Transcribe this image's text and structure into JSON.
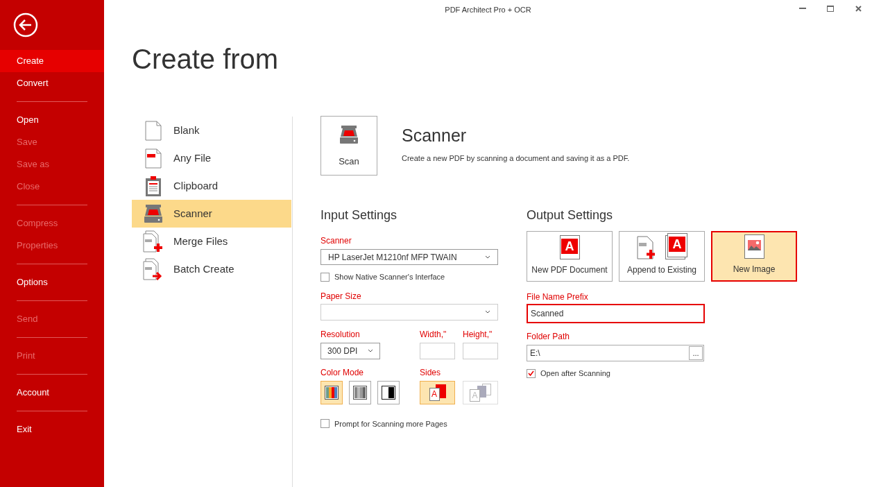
{
  "window": {
    "title": "PDF Architect Pro + OCR"
  },
  "sidebar": {
    "groups": [
      {
        "items": [
          {
            "label": "Create",
            "selected": true,
            "disabled": false
          },
          {
            "label": "Convert",
            "selected": false,
            "disabled": false
          }
        ]
      },
      {
        "items": [
          {
            "label": "Open",
            "selected": false,
            "disabled": false
          },
          {
            "label": "Save",
            "selected": false,
            "disabled": true
          },
          {
            "label": "Save as",
            "selected": false,
            "disabled": true
          },
          {
            "label": "Close",
            "selected": false,
            "disabled": true
          }
        ]
      },
      {
        "items": [
          {
            "label": "Compress",
            "selected": false,
            "disabled": true
          },
          {
            "label": "Properties",
            "selected": false,
            "disabled": true
          }
        ]
      },
      {
        "items": [
          {
            "label": "Options",
            "selected": false,
            "disabled": false
          }
        ]
      },
      {
        "items": [
          {
            "label": "Send",
            "selected": false,
            "disabled": true
          }
        ]
      },
      {
        "items": [
          {
            "label": "Print",
            "selected": false,
            "disabled": true
          }
        ]
      },
      {
        "items": [
          {
            "label": "Account",
            "selected": false,
            "disabled": false
          }
        ]
      },
      {
        "items": [
          {
            "label": "Exit",
            "selected": false,
            "disabled": false
          }
        ]
      }
    ]
  },
  "page_title": "Create from",
  "sources": [
    {
      "label": "Blank",
      "kind": "blank",
      "selected": false
    },
    {
      "label": "Any File",
      "kind": "file",
      "selected": false
    },
    {
      "label": "Clipboard",
      "kind": "clipboard",
      "selected": false
    },
    {
      "label": "Scanner",
      "kind": "scanner",
      "selected": true
    },
    {
      "label": "Merge Files",
      "kind": "merge",
      "selected": false
    },
    {
      "label": "Batch Create",
      "kind": "batch",
      "selected": false
    }
  ],
  "scan_button": {
    "label": "Scan"
  },
  "section": {
    "title": "Scanner",
    "description": "Create a new PDF by scanning a document and saving it as a PDF."
  },
  "input_settings": {
    "title": "Input Settings",
    "scanner": {
      "label": "Scanner",
      "value": "HP LaserJet M1210nf MFP TWAIN"
    },
    "show_native": {
      "label": "Show Native Scanner's Interface",
      "checked": false
    },
    "paper_size": {
      "label": "Paper Size"
    },
    "resolution": {
      "label": "Resolution",
      "value": "300 DPI"
    },
    "width": {
      "label": "Width,\""
    },
    "height": {
      "label": "Height,\""
    },
    "color_mode": {
      "label": "Color Mode",
      "options": [
        {
          "kind": "color",
          "selected": true
        },
        {
          "kind": "grayscale",
          "selected": false
        },
        {
          "kind": "monochrome",
          "selected": false
        }
      ]
    },
    "sides": {
      "label": "Sides",
      "options": [
        {
          "kind": "single",
          "glyph": "A",
          "selected": true,
          "disabled": false
        },
        {
          "kind": "duplex",
          "glyph": "A",
          "selected": false,
          "disabled": true
        }
      ]
    },
    "prompt_more": {
      "label": "Prompt for Scanning more Pages",
      "checked": false
    }
  },
  "output_settings": {
    "title": "Output Settings",
    "targets": [
      {
        "label": "New PDF Document",
        "kind": "new_pdf",
        "glyph": "A",
        "selected": false
      },
      {
        "label": "Append to Existing",
        "kind": "append",
        "glyph": "A",
        "selected": false
      },
      {
        "label": "New Image",
        "kind": "image",
        "selected": true
      }
    ],
    "file_name_prefix": {
      "label": "File Name Prefix",
      "value": "Scanned",
      "highlighted": true
    },
    "folder_path": {
      "label": "Folder Path",
      "value": "E:\\",
      "browse": "..."
    },
    "open_after": {
      "label": "Open after Scanning",
      "checked": true
    }
  }
}
